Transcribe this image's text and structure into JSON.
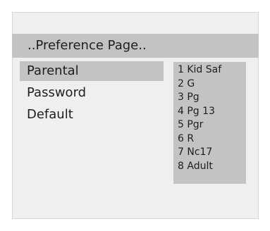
{
  "header": {
    "title": "..Preference Page.."
  },
  "menu": {
    "items": [
      {
        "label": "Parental",
        "selected": true
      },
      {
        "label": "Password",
        "selected": false
      },
      {
        "label": "Default",
        "selected": false
      }
    ]
  },
  "parental_options": [
    "1 Kid Saf",
    "2 G",
    "3 Pg",
    "4 Pg 13",
    "5 Pgr",
    "6 R",
    "7 Nc17",
    "8 Adult"
  ],
  "colors": {
    "panel_background": "#efefef",
    "highlight": "#c3c3c3",
    "text": "#1e1e1e"
  }
}
